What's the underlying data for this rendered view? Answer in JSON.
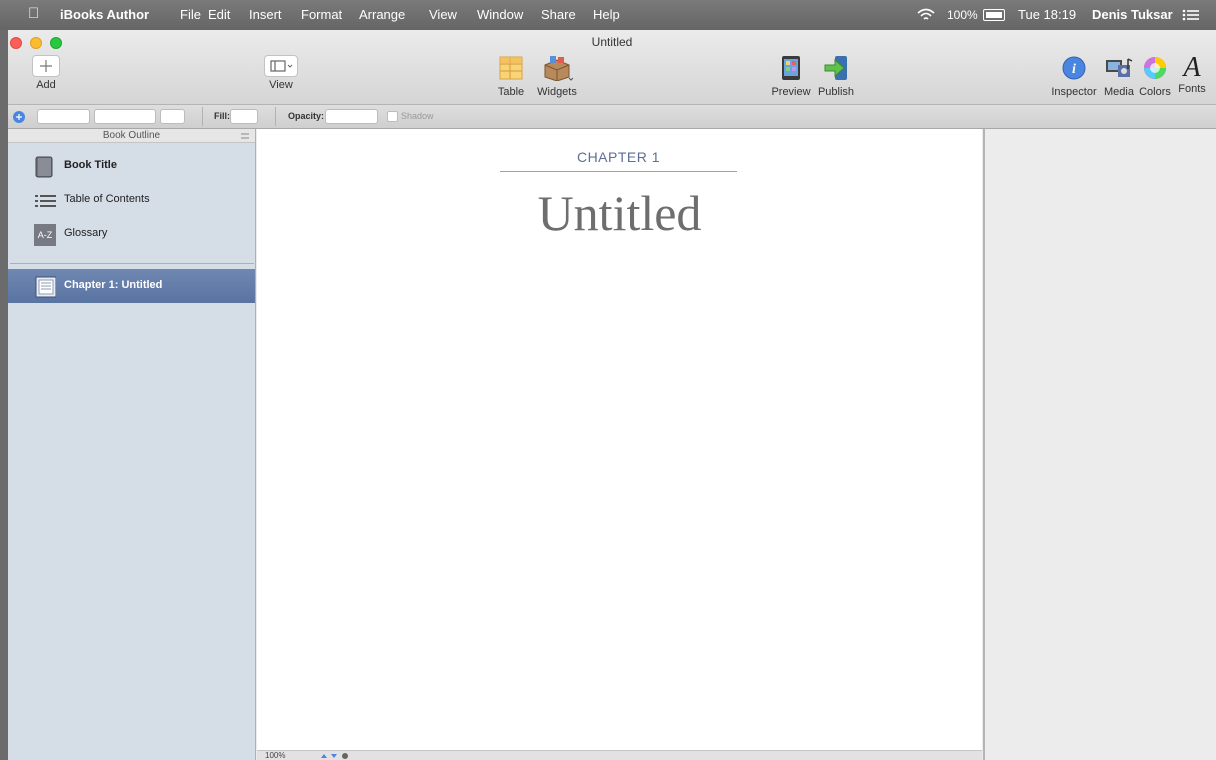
{
  "menubar": {
    "apple": "",
    "items": [
      "iBooks Author",
      "File",
      "Edit",
      "Insert",
      "Format",
      "Arrange",
      "View",
      "Window",
      "Share",
      "Help"
    ],
    "battery": "100%",
    "clock": "Tue 18:19",
    "user": "Denis Tuksar"
  },
  "window": {
    "title": "Untitled"
  },
  "toolbar": {
    "add_label": "Add",
    "view_label": "View",
    "table_label": "Table",
    "widgets_label": "Widgets",
    "preview_label": "Preview",
    "publish_label": "Publish",
    "inspector_label": "Inspector",
    "media_label": "Media",
    "colors_label": "Colors",
    "fonts_label": "Fonts"
  },
  "formatbar": {
    "fill_label": "Fill:",
    "opacity_label": "Opacity:",
    "shadow_label": "Shadow"
  },
  "sidebar": {
    "header": "Book Outline",
    "items": [
      {
        "label": "Book Title",
        "icon": "book-icon"
      },
      {
        "label": "Table of Contents",
        "icon": "list-icon"
      },
      {
        "label": "Glossary",
        "icon": "glossary-icon",
        "icon_text": "A-Z"
      }
    ],
    "chapter": {
      "label": "Chapter 1: Untitled",
      "icon": "chapter-page-icon"
    }
  },
  "canvas": {
    "chapter_label": "CHAPTER 1",
    "chapter_title": "Untitled"
  },
  "bottombar": {
    "zoom": "100%"
  },
  "colors": {
    "selection": "#5a74a2",
    "sidebar_bg": "#d5dde7",
    "chapter_label": "#5d6f95"
  }
}
